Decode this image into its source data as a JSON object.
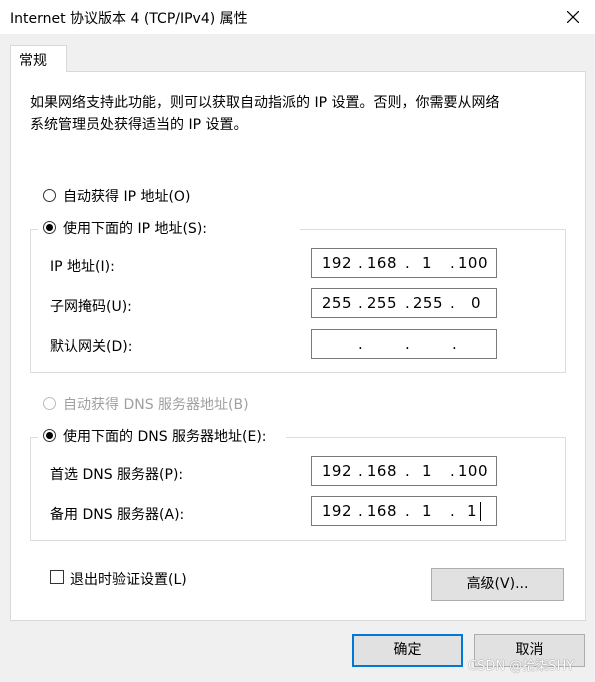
{
  "window": {
    "title": "Internet 协议版本 4 (TCP/IPv4) 属性"
  },
  "tabs": [
    {
      "label": "常规"
    }
  ],
  "description": {
    "line1": "如果网络支持此功能，则可以获取自动指派的 IP 设置。否则，你需要从网络",
    "line2": "系统管理员处获得适当的 IP 设置。"
  },
  "ip_mode": {
    "auto_label": "自动获得 IP 地址(O)",
    "manual_label": "使用下面的 IP 地址(S):",
    "selected": "manual"
  },
  "ip_fields": [
    {
      "label": "IP 地址(I):",
      "octets": [
        "192",
        "168",
        "1",
        "100"
      ]
    },
    {
      "label": "子网掩码(U):",
      "octets": [
        "255",
        "255",
        "255",
        "0"
      ]
    },
    {
      "label": "默认网关(D):",
      "octets": [
        "",
        "",
        "",
        ""
      ]
    }
  ],
  "dns_mode": {
    "auto_label": "自动获得 DNS 服务器地址(B)",
    "manual_label": "使用下面的 DNS 服务器地址(E):",
    "selected": "manual",
    "auto_disabled": true
  },
  "dns_fields": [
    {
      "label": "首选 DNS 服务器(P):",
      "octets": [
        "192",
        "168",
        "1",
        "100"
      ]
    },
    {
      "label": "备用 DNS 服务器(A):",
      "octets": [
        "192",
        "168",
        "1",
        "1"
      ]
    }
  ],
  "validate_on_exit": {
    "label": "退出时验证设置(L)",
    "checked": false
  },
  "buttons": {
    "advanced": "高级(V)...",
    "ok": "确定",
    "cancel": "取消"
  },
  "watermark": "CSDN @拾柒SHY",
  "colors": {
    "focus_border": "#0078d7",
    "button_face": "#e1e1e1",
    "disabled_text": "#a0a0a0"
  }
}
